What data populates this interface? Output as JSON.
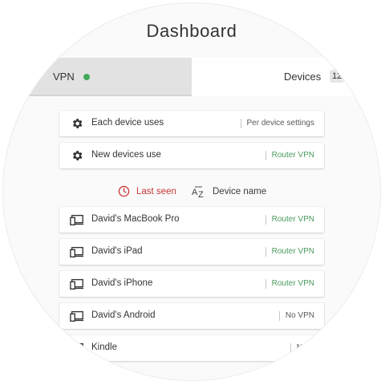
{
  "header": {
    "title": "Dashboard"
  },
  "tabs": {
    "vpn": {
      "label": "VPN",
      "status_color": "#45a85a"
    },
    "devices": {
      "label": "Devices",
      "count": "12"
    }
  },
  "settings": [
    {
      "label": "Each device uses",
      "value": "Per device settings",
      "icon": "gear-icon"
    },
    {
      "label": "New devices use",
      "value": "Router VPN",
      "icon": "gear-icon"
    }
  ],
  "sort": {
    "last_seen": "Last seen",
    "device_name": "Device name",
    "active_color": "#c8373b"
  },
  "devices": [
    {
      "name": "David's MacBook Pro",
      "vpn": "Router VPN",
      "icon": "devices-icon"
    },
    {
      "name": "David's iPad",
      "vpn": "Router VPN",
      "icon": "devices-icon"
    },
    {
      "name": "David's iPhone",
      "vpn": "Router VPN",
      "icon": "devices-icon"
    },
    {
      "name": "David's Android",
      "vpn": "No VPN",
      "icon": "devices-icon"
    },
    {
      "name": "Kindle",
      "vpn": "No V",
      "icon": "devices-icon"
    }
  ],
  "colors": {
    "accent_green": "#4a9a5e",
    "accent_red": "#c8373b"
  }
}
